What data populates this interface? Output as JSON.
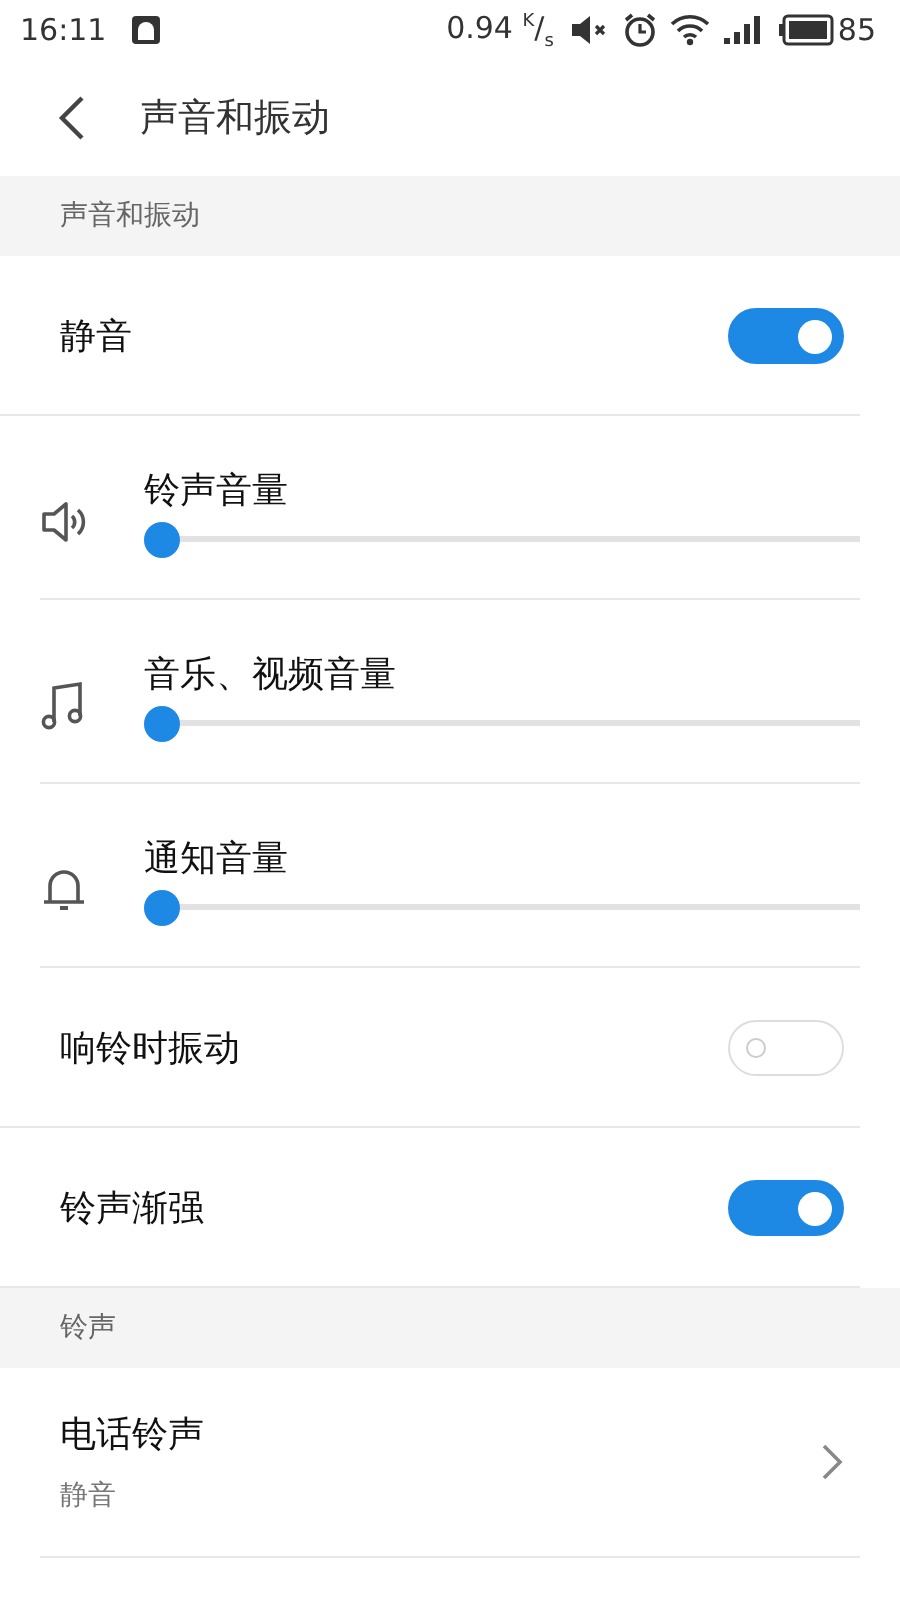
{
  "status_bar": {
    "time": "16:11",
    "speed": "0.94 $^{K}$/$_{s}$",
    "battery": "85"
  },
  "header": {
    "title": "声音和振动"
  },
  "sections": [
    {
      "title": "声音和振动",
      "rows": [
        {
          "kind": "toggle",
          "label": "静音",
          "on": true
        },
        {
          "kind": "slider",
          "label": "铃声音量",
          "level": 0
        },
        {
          "kind": "slider",
          "label": "音乐、视频音量",
          "level": 0
        },
        {
          "kind": "slider",
          "label": "通知音量",
          "level": 0
        },
        {
          "kind": "toggle",
          "label": "响铃时振动",
          "on": false
        },
        {
          "kind": "toggle",
          "label": "铃声渐强",
          "on": true
        }
      ]
    },
    {
      "title": "铃声",
      "rows": [
        {
          "kind": "link",
          "label": "电话铃声",
          "value": "静音"
        }
      ]
    }
  ]
}
